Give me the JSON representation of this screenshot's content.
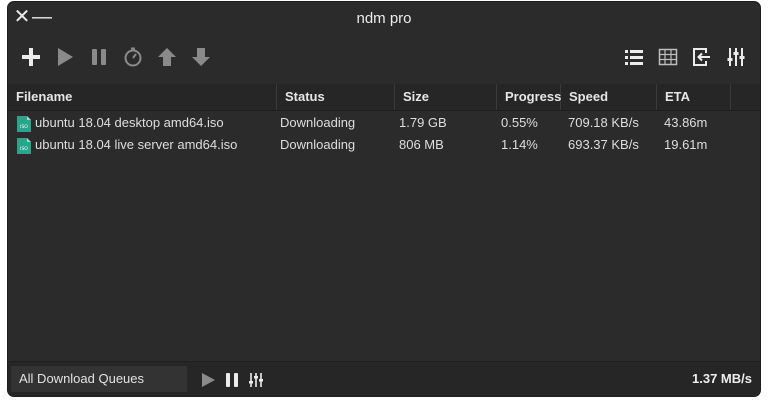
{
  "window": {
    "title": "ndm pro",
    "close_glyph": "✕",
    "minimize_glyph": "—"
  },
  "toolbar": {
    "left_icons": [
      "add-icon",
      "play-icon",
      "pause-icon",
      "timer-icon",
      "move-up-icon",
      "move-down-icon"
    ],
    "right_icons": [
      "list-view-icon",
      "grid-view-icon",
      "export-icon",
      "settings-sliders-icon"
    ]
  },
  "table": {
    "columns": {
      "filename": "Filename",
      "status": "Status",
      "size": "Size",
      "progress": "Progress",
      "speed": "Speed",
      "eta": "ETA"
    },
    "rows": [
      {
        "filename": "ubuntu 18.04 desktop amd64.iso",
        "status": "Downloading",
        "size": "1.79 GB",
        "progress": "0.55%",
        "speed": "709.18 KB/s",
        "eta": "43.86m",
        "icon": "iso-file-icon"
      },
      {
        "filename": "ubuntu 18.04 live server amd64.iso",
        "status": "Downloading",
        "size": "806 MB",
        "progress": "1.14%",
        "speed": "693.37 KB/s",
        "eta": "19.61m",
        "icon": "iso-file-icon"
      }
    ]
  },
  "footer": {
    "queue_selected": "All Download Queues",
    "total_speed": "1.37 MB/s"
  },
  "colors": {
    "window_bg": "#2b2b2b",
    "header_bg": "#262626",
    "icon_active": "#ececec",
    "icon_disabled": "#8a8a8a",
    "iso_icon": "#2aa58a"
  }
}
